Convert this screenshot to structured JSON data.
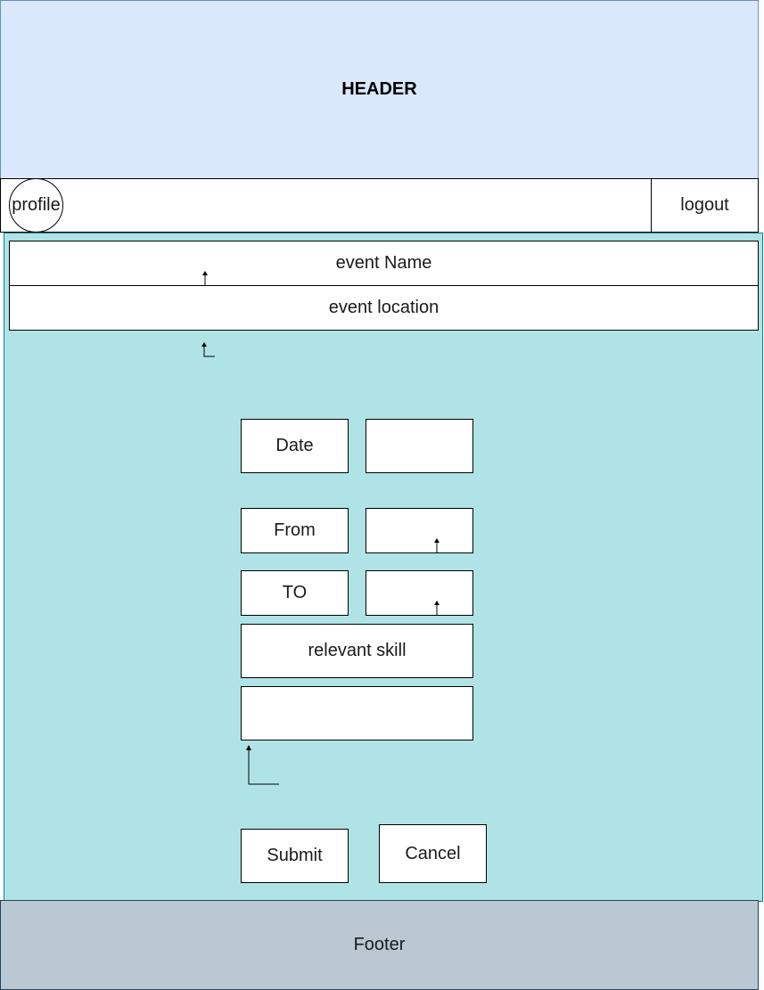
{
  "header": {
    "title": "HEADER"
  },
  "nav": {
    "profile_label": "profile",
    "logout_label": "logout"
  },
  "form": {
    "event_name_label": "event Name",
    "event_location_label": "event location",
    "date_label": "Date",
    "date_value": "",
    "from_label": "From",
    "from_value": "",
    "to_label": "TO",
    "to_value": "",
    "skill_label": "relevant skill",
    "skill_value": "",
    "submit_label": "Submit",
    "cancel_label": "Cancel"
  },
  "footer": {
    "label": "Footer"
  },
  "colors": {
    "header_bg": "#dae8fc",
    "main_bg": "#b0e3e6",
    "footer_bg": "#bac8d3"
  }
}
